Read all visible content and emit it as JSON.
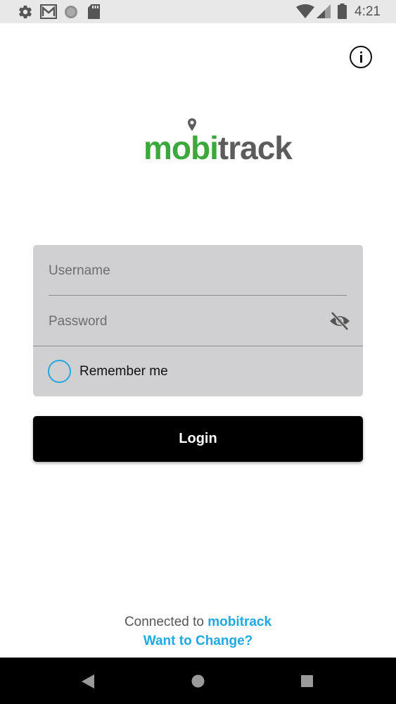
{
  "status_bar": {
    "time": "4:21",
    "left_icons": [
      "settings-icon",
      "gmail-icon",
      "circle-icon",
      "sd-card-icon"
    ],
    "right_icons": [
      "wifi-icon",
      "signal-icon",
      "battery-icon"
    ]
  },
  "logo": {
    "part1": "mobi",
    "part2": "track"
  },
  "form": {
    "username_placeholder": "Username",
    "username_value": "",
    "password_placeholder": "Password",
    "password_value": "",
    "remember_label": "Remember me",
    "remember_checked": false
  },
  "login_button": {
    "label": "Login"
  },
  "footer": {
    "connected_prefix": "Connected to",
    "server_name": "mobitrack",
    "change_link": "Want to Change?"
  },
  "colors": {
    "accent": "#1fa9e0",
    "logo_green": "#3aa83b",
    "logo_gray": "#5c5c5c",
    "card_bg": "#d0cfd1",
    "button_bg": "#000000"
  },
  "nav_bar": {
    "buttons": [
      "back-icon",
      "home-icon",
      "recents-icon"
    ]
  }
}
